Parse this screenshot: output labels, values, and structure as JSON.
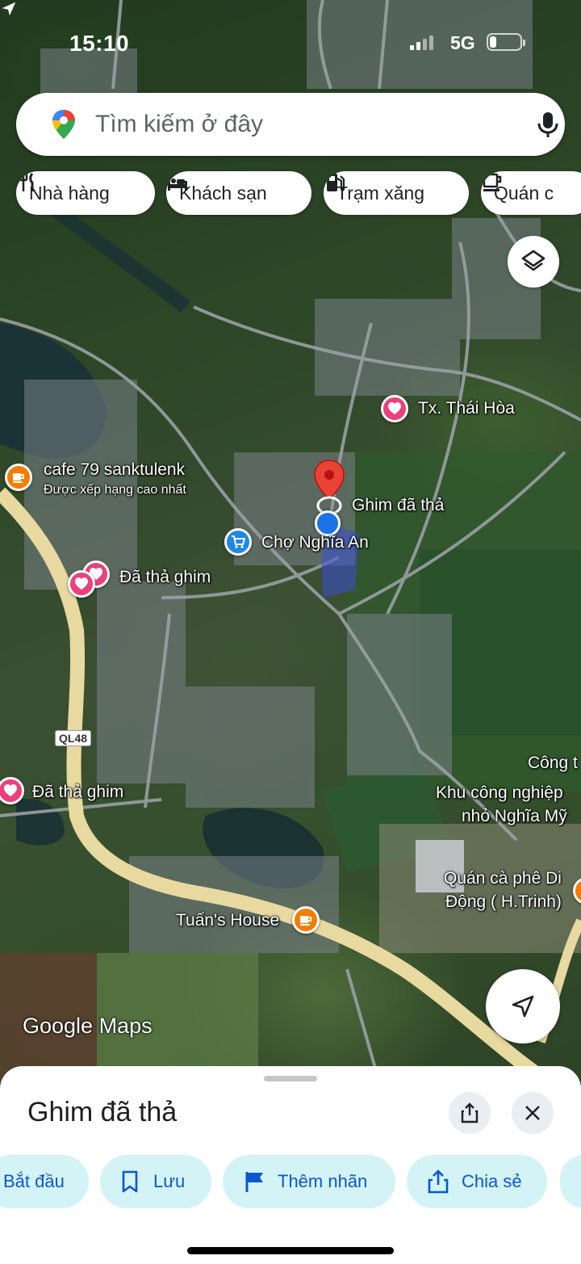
{
  "status_bar": {
    "time": "15:10",
    "network": "5G"
  },
  "search": {
    "placeholder": "Tìm kiếm ở đây"
  },
  "chips": [
    {
      "label": "Nhà hàng",
      "icon": "restaurant-icon"
    },
    {
      "label": "Khách sạn",
      "icon": "hotel-icon"
    },
    {
      "label": "Trạm xăng",
      "icon": "gas-station-icon"
    },
    {
      "label": "Quán c",
      "icon": "coffee-icon"
    }
  ],
  "map": {
    "labels": {
      "thai_hoa": "Tx. Thái Hòa",
      "cafe79": "cafe 79 sanktulenk",
      "cafe79_sub": "Được xếp hạng cao nhất",
      "dropped_pin": "Ghim đã thả",
      "cho_nghia_an": "Chợ Nghĩa An",
      "pinned_1": "Đã thả ghim",
      "pinned_2": "Đã thả ghim",
      "road_ql48": "QL48",
      "cong": "Công t",
      "kcn_1": "Khu công nghiệp",
      "kcn_2": "nhỏ Nghĩa Mỹ",
      "quan_ca_phe_1": "Quán cà phê Di",
      "quan_ca_phe_2": "Động ( H.Trinh)",
      "tuans_house": "Tuấn's House"
    },
    "logo": "Google Maps"
  },
  "sheet": {
    "title": "Ghim đã thả",
    "actions": [
      {
        "label": "Bắt đầu",
        "icon": "navigation-icon"
      },
      {
        "label": "Lưu",
        "icon": "bookmark-icon"
      },
      {
        "label": "Thêm nhãn",
        "icon": "flag-icon"
      },
      {
        "label": "Chia sẻ",
        "icon": "share-icon"
      }
    ]
  },
  "colors": {
    "pin_red": "#ea4335",
    "marker_pink": "#ec407a",
    "marker_orange": "#f57c00",
    "marker_blue": "#1e88e5",
    "action_bg": "#d3f3f6",
    "action_text": "#0b57d0",
    "road_yellow": "#e8d9a0"
  }
}
